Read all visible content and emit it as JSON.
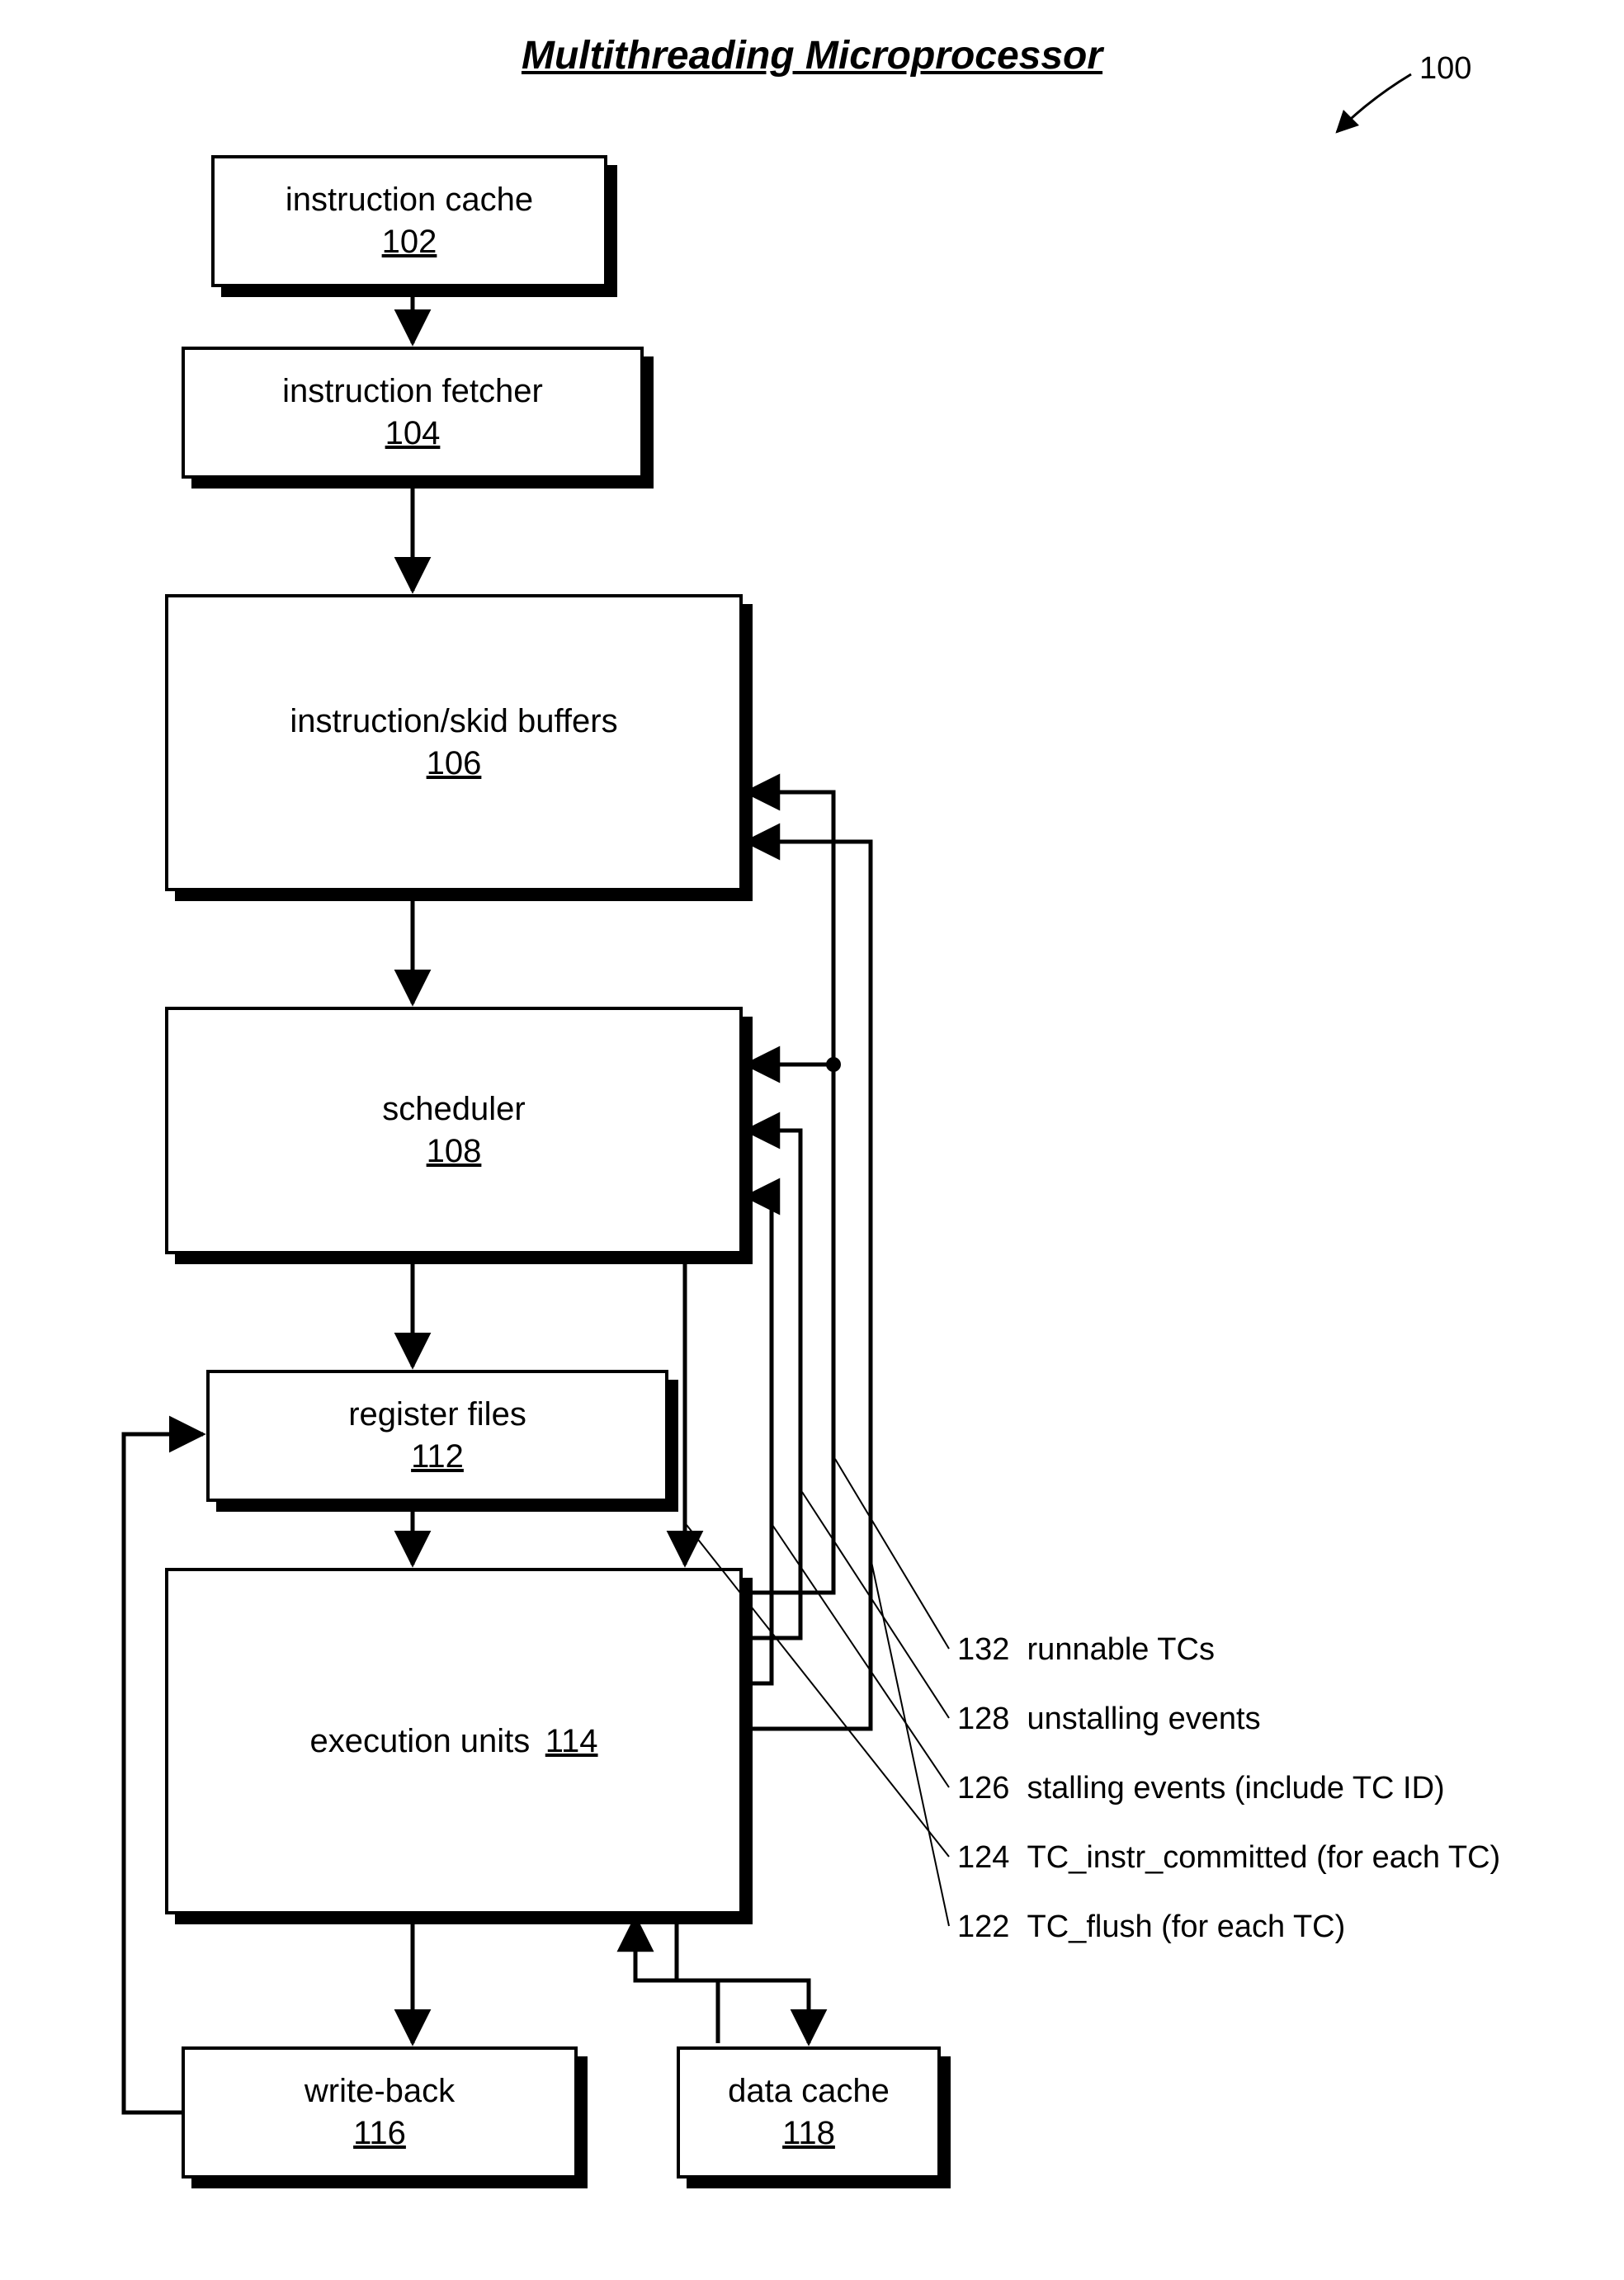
{
  "title": "Multithreading Microprocessor",
  "figure_ref": "100",
  "blocks": {
    "icache": {
      "label": "instruction cache",
      "num": "102"
    },
    "ifetch": {
      "label": "instruction fetcher",
      "num": "104"
    },
    "iskid": {
      "label": "instruction/skid buffers",
      "num": "106"
    },
    "sched": {
      "label": "scheduler",
      "num": "108"
    },
    "regfile": {
      "label": "register files",
      "num": "112"
    },
    "exec": {
      "label": "execution units",
      "num": "114"
    },
    "wb": {
      "label": "write-back",
      "num": "116"
    },
    "dcache": {
      "label": "data cache",
      "num": "118"
    }
  },
  "signals": {
    "s132": {
      "num": "132",
      "label": "runnable TCs"
    },
    "s128": {
      "num": "128",
      "label": "unstalling events"
    },
    "s126": {
      "num": "126",
      "label": "stalling events (include TC ID)"
    },
    "s124": {
      "num": "124",
      "label": "TC_instr_committed (for each TC)"
    },
    "s122": {
      "num": "122",
      "label": "TC_flush (for each TC)"
    }
  }
}
